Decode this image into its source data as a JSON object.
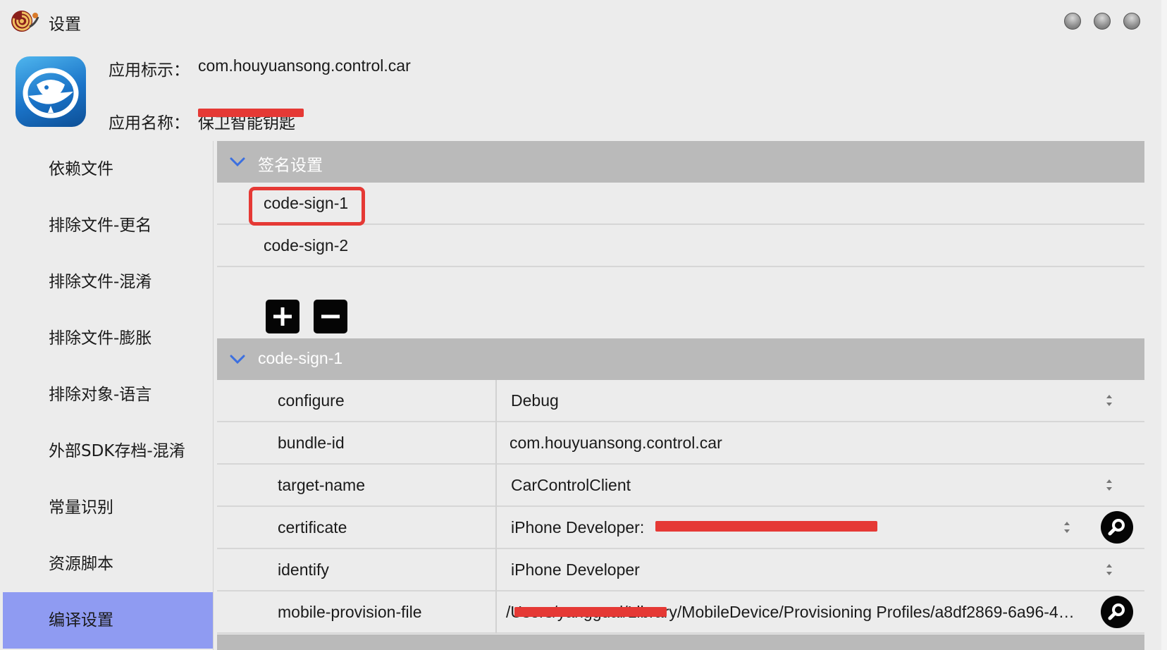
{
  "window": {
    "title": "设置",
    "controls": [
      "close",
      "minimize",
      "zoom"
    ]
  },
  "app_info": {
    "identifier_label": "应用标示：",
    "identifier_value": "com.houyuansong.control.car",
    "name_label": "应用名称：",
    "name_value": "保卫智能钥匙",
    "icon": "whale-app-icon"
  },
  "sidebar": {
    "items": [
      {
        "label": "依赖文件"
      },
      {
        "label": "排除文件-更名"
      },
      {
        "label": "排除文件-混淆"
      },
      {
        "label": "排除文件-膨胀"
      },
      {
        "label": "排除对象-语言"
      },
      {
        "label": "外部SDK存档-混淆"
      },
      {
        "label": "常量识别"
      },
      {
        "label": "资源脚本"
      },
      {
        "label": "编译设置",
        "active": true
      }
    ]
  },
  "signing": {
    "section_title": "签名设置",
    "entries": [
      "code-sign-1",
      "code-sign-2"
    ],
    "highlighted": "code-sign-1",
    "add_icon": "plus-icon",
    "remove_icon": "minus-icon"
  },
  "detail": {
    "section_title": "code-sign-1",
    "rows": [
      {
        "key": "configure",
        "value": "Debug",
        "stepper": true,
        "search": false
      },
      {
        "key": "bundle-id",
        "value": "com.houyuansong.control.car",
        "stepper": false,
        "search": false
      },
      {
        "key": "target-name",
        "value": "CarControlClient",
        "stepper": true,
        "search": false
      },
      {
        "key": "certificate",
        "value": "iPhone Developer:",
        "stepper": true,
        "search": true
      },
      {
        "key": "identify",
        "value": "iPhone Developer",
        "stepper": true,
        "search": false
      },
      {
        "key": "mobile-provision-file",
        "value": "/Users/yangguai/Library/MobileDevice/Provisioning Profiles/a8df2869-6a96-4…",
        "stepper": false,
        "search": true
      }
    ]
  },
  "colors": {
    "active_sidebar": "#8f9bf2",
    "section_header": "#bababa",
    "redaction": "#e53935",
    "chevron": "#3b6fe0"
  }
}
